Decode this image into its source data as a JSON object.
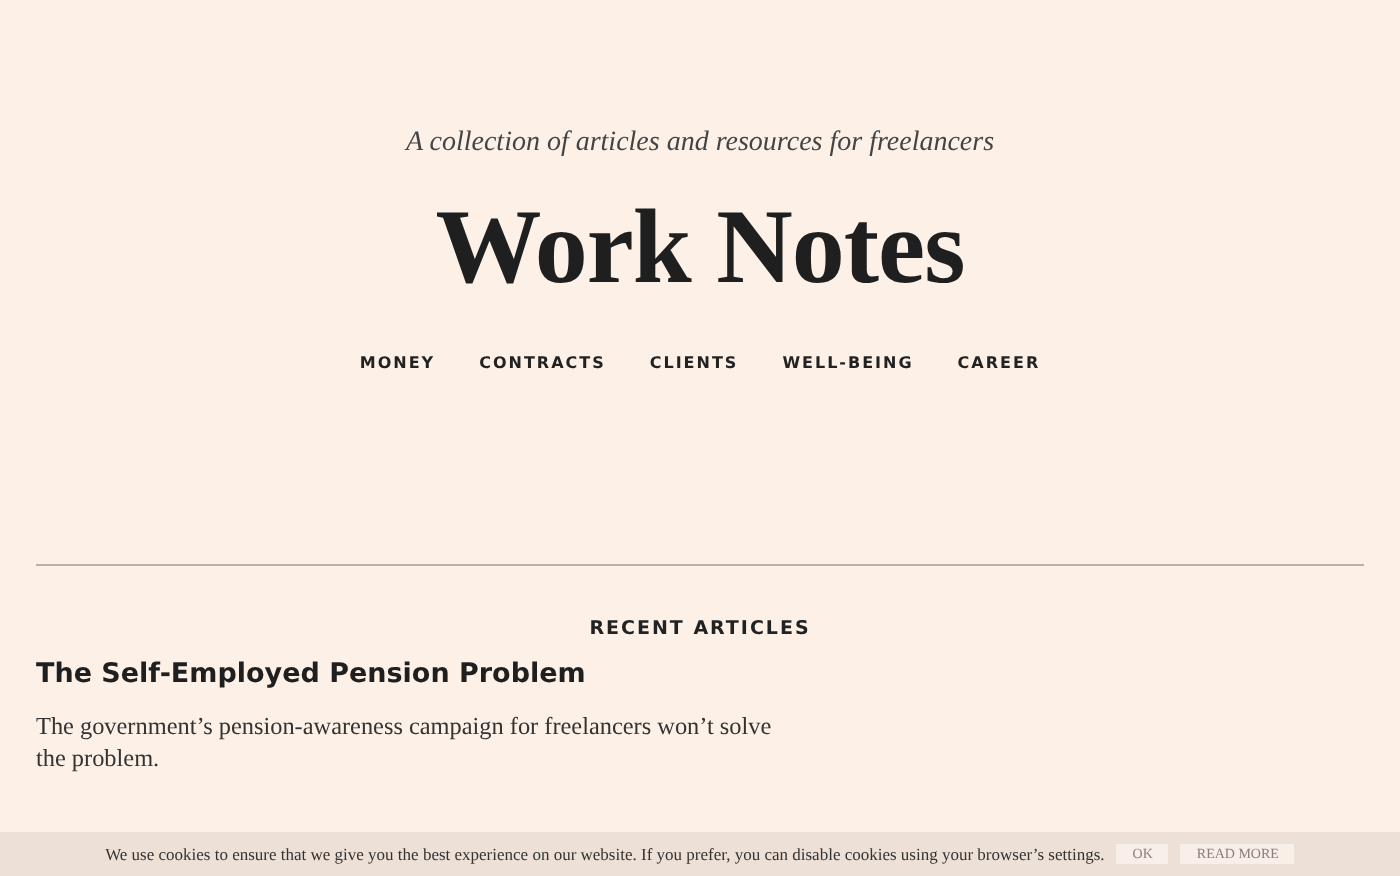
{
  "header": {
    "tagline": "A collection of articles and resources for freelancers",
    "title": "Work Notes"
  },
  "nav": [
    "MONEY",
    "CONTRACTS",
    "CLIENTS",
    "WELL-BEING",
    "CAREER"
  ],
  "section_title": "RECENT ARTICLES",
  "articles": [
    {
      "title": "The Self-Employed Pension Problem",
      "excerpt": "The government’s pension-awareness campaign for freelancers won’t solve the problem."
    }
  ],
  "cookie_bar": {
    "message": "We use cookies to ensure that we give you the best experience on our website. If you prefer, you can disable cookies using your browser’s settings.",
    "buttons": [
      "OK",
      "READ MORE"
    ]
  }
}
